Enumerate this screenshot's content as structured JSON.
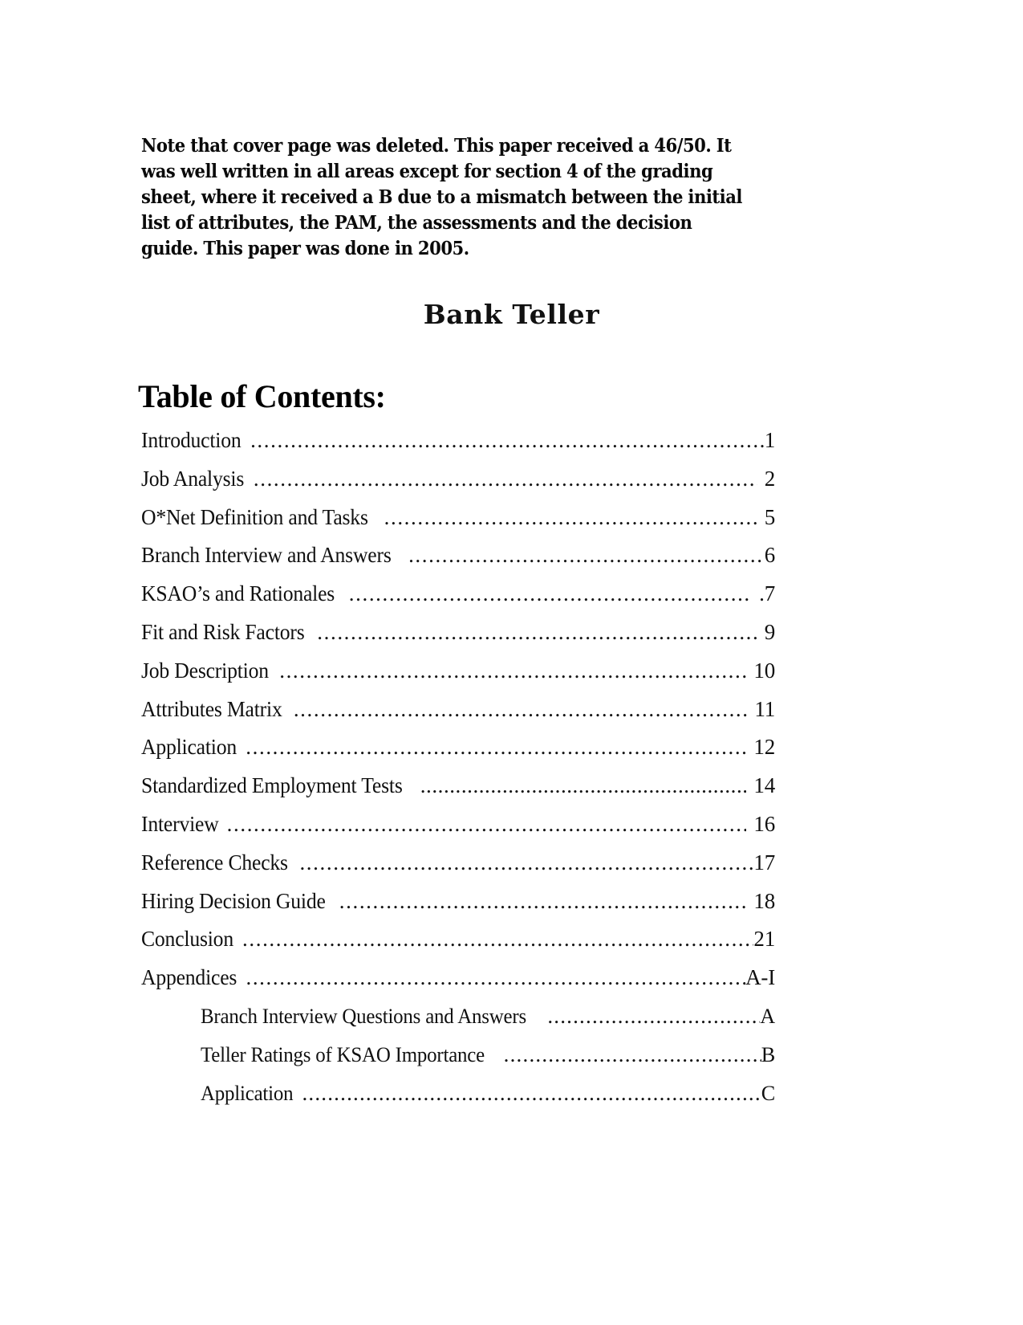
{
  "document": {
    "instructor_note": "Note that cover page was deleted.  This paper received a 46/50.  It was well written in all areas except for section 4 of the grading sheet, where it received a B due to a mismatch between the initial list of attributes, the PAM, the assessments and the decision guide. This paper was done in 2005.",
    "title": "Bank Teller",
    "toc_heading": "Table of Contents:"
  },
  "toc": {
    "entries": [
      {
        "label": "Introduction",
        "page": "1"
      },
      {
        "label": "Job Analysis",
        "page": "2"
      },
      {
        "label": "O*Net Definition and Tasks",
        "page": "5"
      },
      {
        "label": "Branch Interview and Answers",
        "page": "6"
      },
      {
        "label": "KSAO’s and Rationales",
        "page": ".7"
      },
      {
        "label": "Fit and Risk Factors",
        "page": "9"
      },
      {
        "label": "Job Description",
        "page": "10"
      },
      {
        "label": "Attributes Matrix",
        "page": "11"
      },
      {
        "label": "Application",
        "page": "12"
      },
      {
        "label": "Standardized Employment Tests",
        "page": "14"
      },
      {
        "label": "Interview",
        "page": "16"
      },
      {
        "label": "Reference Checks",
        "page": "17"
      },
      {
        "label": "Hiring Decision Guide",
        "page": "18"
      },
      {
        "label": "Conclusion",
        "page": "21"
      },
      {
        "label": "Appendices",
        "page": "A-I"
      }
    ],
    "appendix_entries": [
      {
        "label": "Branch Interview Questions and Answers",
        "page": "A"
      },
      {
        "label": "Teller Ratings of KSAO Importance",
        "page": "B"
      },
      {
        "label": "Application",
        "page": "C"
      }
    ]
  }
}
